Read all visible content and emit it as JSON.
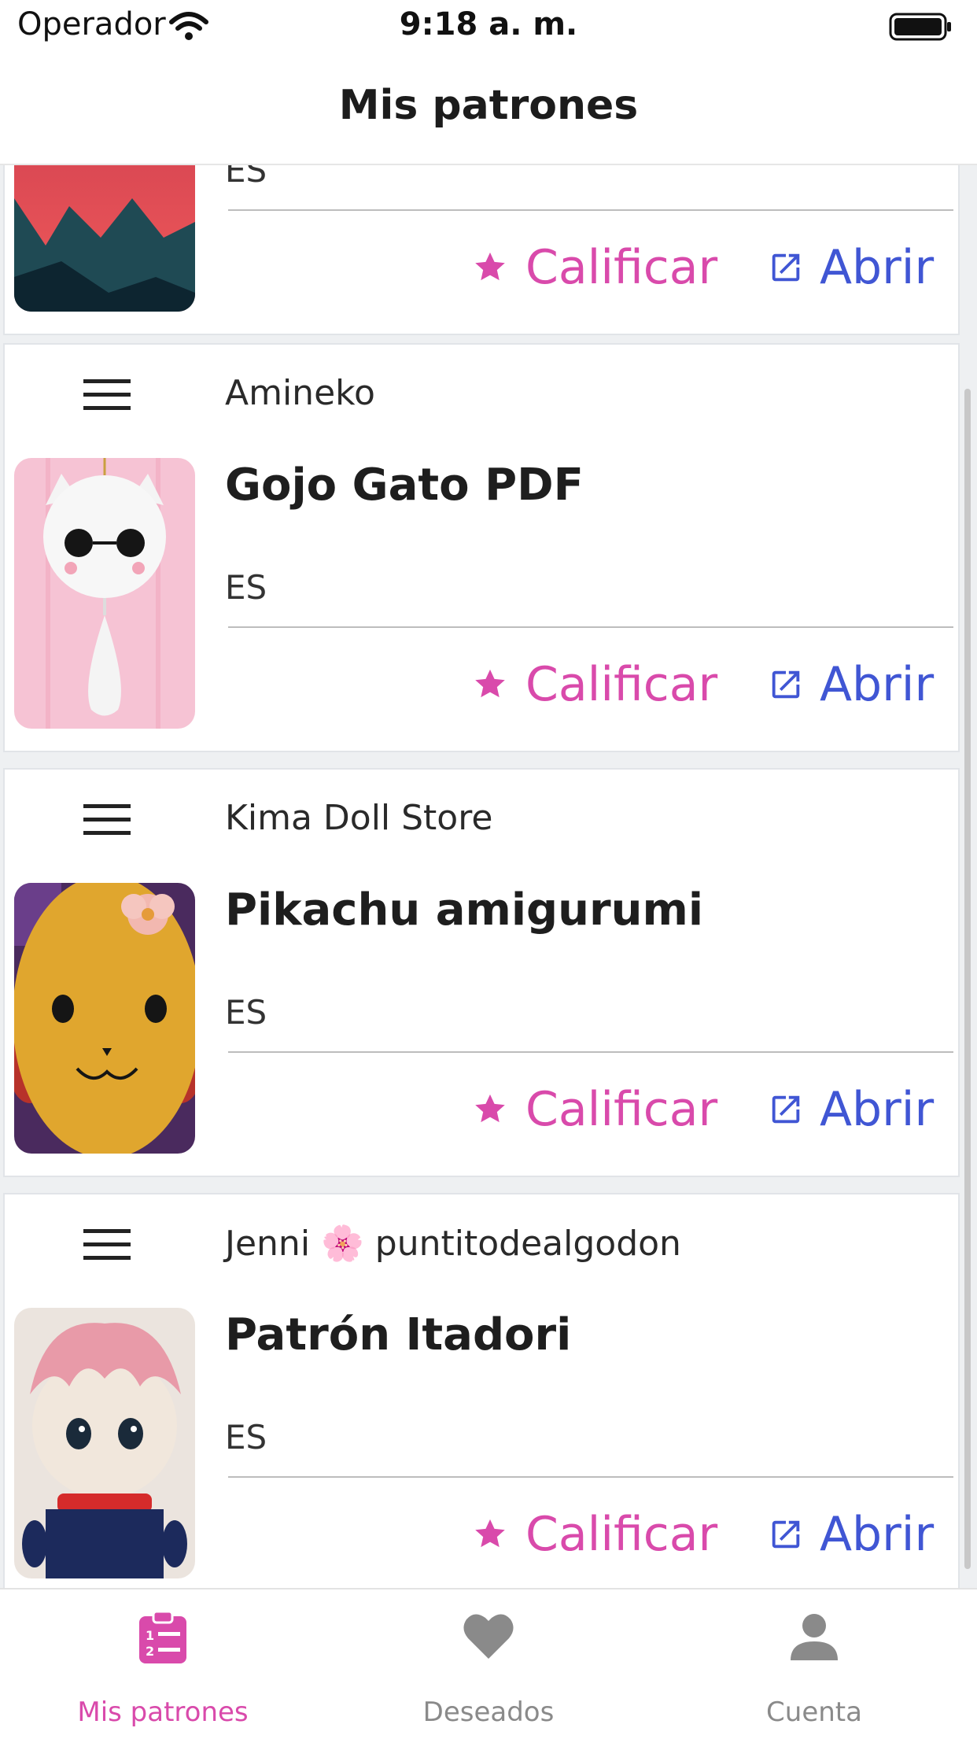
{
  "status_bar": {
    "carrier": "Operador",
    "time": "9:18 a. m."
  },
  "nav": {
    "title": "Mis patrones"
  },
  "patterns": [
    {
      "author": "",
      "title": "",
      "lang": "ES",
      "rate_label": "Calificar",
      "open_label": "Abrir",
      "thumb_icon": "mountain-thumbnail"
    },
    {
      "author": "Amineko",
      "title": "Gojo Gato PDF",
      "lang": "ES",
      "rate_label": "Calificar",
      "open_label": "Abrir",
      "thumb_icon": "white-cat-amigurumi-thumbnail"
    },
    {
      "author": "Kima Doll Store",
      "title": "Pikachu amigurumi",
      "lang": "ES",
      "rate_label": "Calificar",
      "open_label": "Abrir",
      "thumb_icon": "yellow-pikachu-amigurumi-thumbnail"
    },
    {
      "author": "Jenni 🌸 puntitodealgodon",
      "title": "Patrón Itadori",
      "lang": "ES",
      "rate_label": "Calificar",
      "open_label": "Abrir",
      "thumb_icon": "itadori-doll-thumbnail"
    }
  ],
  "tabs": [
    {
      "label": "Mis patrones",
      "icon": "clipboard-list-icon",
      "active": true
    },
    {
      "label": "Deseados",
      "icon": "heart-icon",
      "active": false
    },
    {
      "label": "Cuenta",
      "icon": "user-icon",
      "active": false
    }
  ],
  "colors": {
    "accent_pink": "#d94aab",
    "accent_blue": "#4056d4",
    "inactive_gray": "#8a8a8a"
  }
}
